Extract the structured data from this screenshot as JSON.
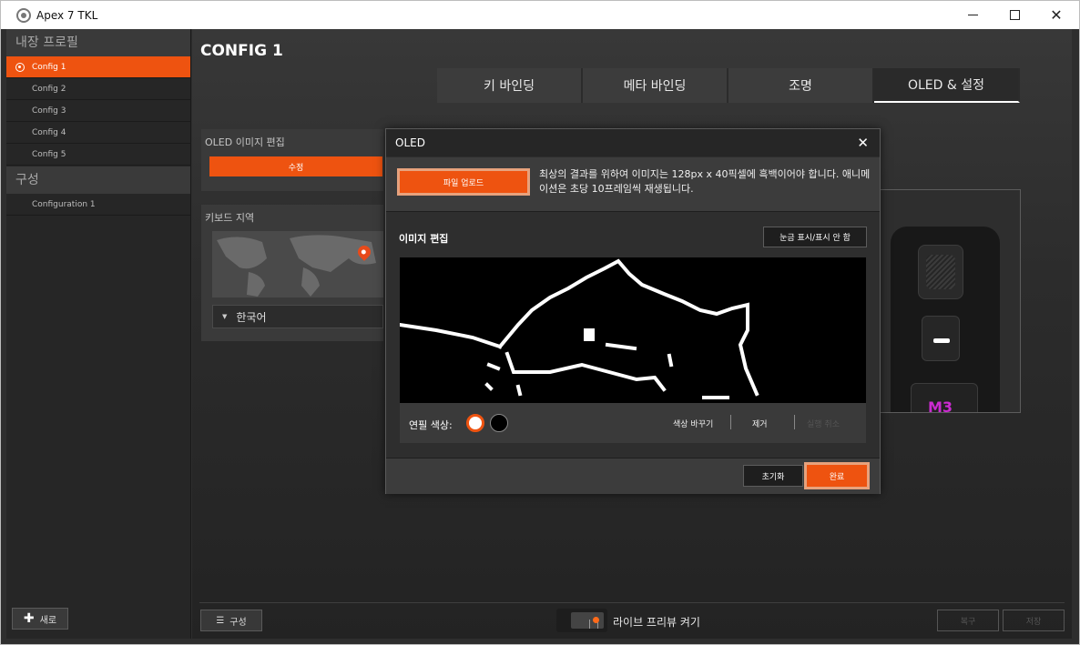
{
  "window": {
    "title": "Apex 7 TKL"
  },
  "sidebar": {
    "profiles_header": "내장 프로필",
    "profiles": [
      {
        "label": "Config 1",
        "active": true
      },
      {
        "label": "Config 2",
        "active": false
      },
      {
        "label": "Config 3",
        "active": false
      },
      {
        "label": "Config 4",
        "active": false
      },
      {
        "label": "Config 5",
        "active": false
      }
    ],
    "configs_header": "구성",
    "configs": [
      {
        "label": "Configuration 1"
      }
    ],
    "new_button": "새로"
  },
  "main": {
    "config_title": "CONFIG 1",
    "tabs": [
      {
        "label": "키 바인딩",
        "active": false
      },
      {
        "label": "메타 바인딩",
        "active": false
      },
      {
        "label": "조명",
        "active": false
      },
      {
        "label": "OLED & 설정",
        "active": true
      }
    ],
    "oled_panel": {
      "label": "OLED 이미지 편집",
      "edit_button": "수정"
    },
    "keyboard_panel": {
      "label": "키보드 지역",
      "language": "한국어"
    },
    "preview": {
      "macro_key": "M3"
    }
  },
  "bottom": {
    "config_button": "구성",
    "live_preview_label": "라이브 프리뷰 켜기",
    "restore_button": "복구",
    "save_button": "저장"
  },
  "dialog": {
    "title": "OLED",
    "upload_button": "파일 업로드",
    "upload_note": "최상의 결과를 위하여 이미지는 128px x 40픽셀에 흑백이어야 합니다. 애니메이션은 초당 10프레임씩 재생됩니다.",
    "edit_title": "이미지 편집",
    "grid_button": "눈금 표시/표시 안 함",
    "pen_color_label": "연필 색상:",
    "swap_colors": "색상 바꾸기",
    "remove": "제거",
    "disabled_action": "실행 취소",
    "reset_button": "초기화",
    "done_button": "완료"
  },
  "colors": {
    "accent": "#ee5310",
    "background": "#2e2e2e",
    "macro_key": "#cc2bd1"
  }
}
